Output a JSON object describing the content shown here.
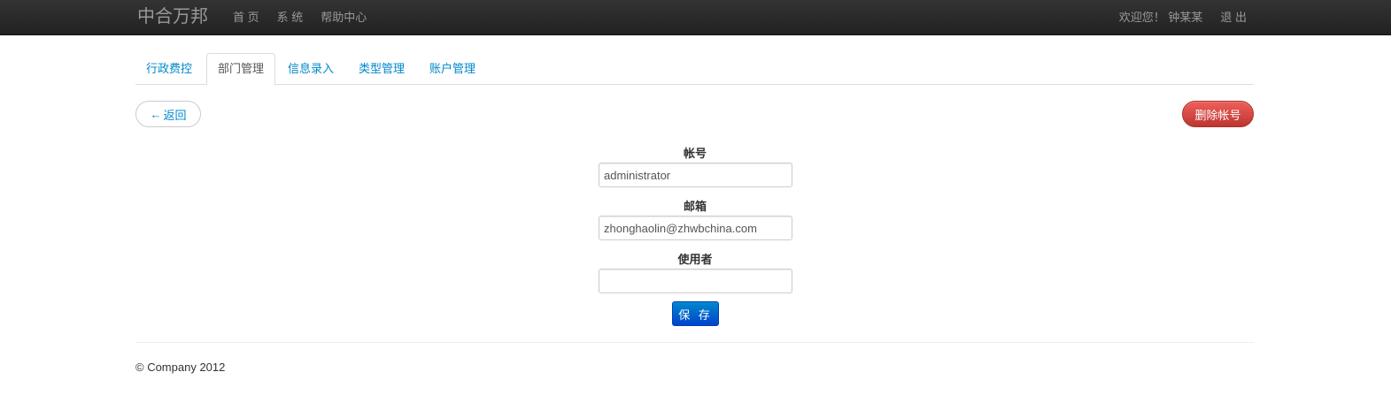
{
  "navbar": {
    "brand": "中合万邦",
    "links": [
      "首 页",
      "系 统",
      "帮助中心"
    ],
    "welcome": "欢迎您！ 钟某某",
    "logout": "退 出"
  },
  "tabs": [
    {
      "label": "行政费控",
      "active": false
    },
    {
      "label": "部门管理",
      "active": true
    },
    {
      "label": "信息录入",
      "active": false
    },
    {
      "label": "类型管理",
      "active": false
    },
    {
      "label": "账户管理",
      "active": false
    }
  ],
  "actions": {
    "back_arrow": "←",
    "back_label": "返回",
    "delete_label": "删除帐号"
  },
  "form": {
    "account_label": "帐号",
    "account_value": "administrator",
    "email_label": "邮箱",
    "email_value": "zhonghaolin@zhwbchina.com",
    "user_label": "使用者",
    "user_value": "",
    "save_label": "保 存"
  },
  "footer": {
    "copyright": "© Company 2012"
  },
  "colors": {
    "navbar_bg": "#222222",
    "link": "#0088cc",
    "danger": "#da4f49",
    "primary": "#0074cc"
  }
}
